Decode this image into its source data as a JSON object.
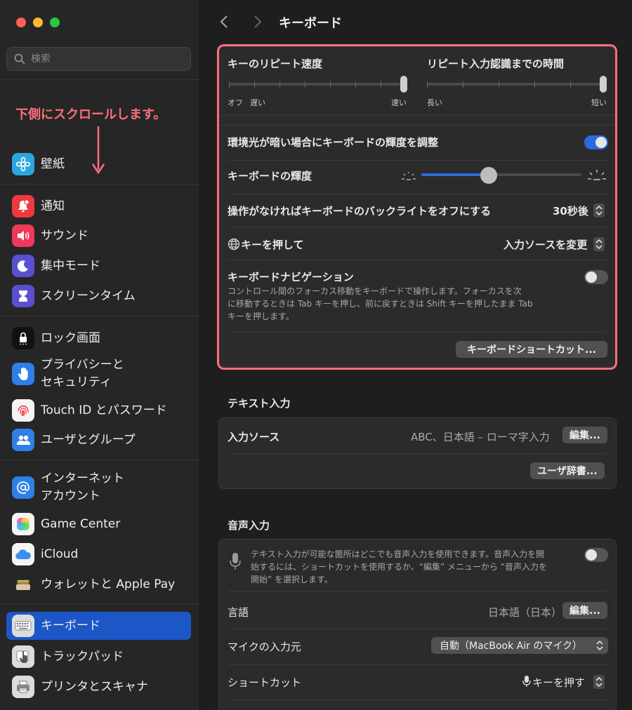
{
  "window": {
    "controls": [
      "close",
      "minimize",
      "zoom"
    ],
    "colors": {
      "close": "#ff5f57",
      "minimize": "#febc2e",
      "zoom": "#28c840"
    }
  },
  "search": {
    "placeholder": "検索"
  },
  "annotation": {
    "text": "下側にスクロールします。",
    "color": "#ff6f7d"
  },
  "sidebar": {
    "items": [
      {
        "label": "壁紙",
        "icon": "wallpaper-icon"
      },
      {
        "label": "通知",
        "icon": "notification-bell-icon"
      },
      {
        "label": "サウンド",
        "icon": "speaker-icon"
      },
      {
        "label": "集中モード",
        "icon": "moon-icon"
      },
      {
        "label": "スクリーンタイム",
        "icon": "hourglass-icon"
      },
      {
        "label": "ロック画面",
        "icon": "lock-icon"
      },
      {
        "label": "プライバシーと\nセキュリティ",
        "icon": "hand-icon"
      },
      {
        "label": "Touch ID とパスワード",
        "icon": "fingerprint-icon"
      },
      {
        "label": "ユーザとグループ",
        "icon": "users-icon"
      },
      {
        "label": "インターネット\nアカウント",
        "icon": "at-sign-icon"
      },
      {
        "label": "Game Center",
        "icon": "game-center-icon"
      },
      {
        "label": "iCloud",
        "icon": "cloud-icon"
      },
      {
        "label": "ウォレットと Apple Pay",
        "icon": "wallet-icon"
      },
      {
        "label": "キーボード",
        "icon": "keyboard-icon",
        "selected": true
      },
      {
        "label": "トラックパッド",
        "icon": "trackpad-icon"
      },
      {
        "label": "プリンタとスキャナ",
        "icon": "printer-icon"
      }
    ]
  },
  "page": {
    "title": "キーボード"
  },
  "keyboard": {
    "repeat_speed": {
      "label": "キーのリピート速度",
      "min_label": "オフ",
      "left_label": "遅い",
      "right_label": "速い",
      "value_fraction": 1.0
    },
    "repeat_delay": {
      "label": "リピート入力認識までの時間",
      "left_label": "長い",
      "right_label": "短い",
      "value_fraction": 1.0
    },
    "ambient_light": {
      "label": "環境光が暗い場合にキーボードの輝度を調整",
      "on": true
    },
    "brightness": {
      "label": "キーボードの輝度",
      "value_fraction": 0.42
    },
    "backlight_off": {
      "label": "操作がなければキーボードのバックライトをオフにする",
      "value": "30秒後"
    },
    "globe_key": {
      "label": "キーを押して",
      "value": "入力ソースを変更"
    },
    "navigation": {
      "label": "キーボードナビゲーション",
      "on": false,
      "desc_line1": "コントロール間のフォーカス移動をキーボードで操作します。フォーカスを次",
      "desc_line2": "に移動するときは Tab キーを押し、前に戻すときは Shift キーを押したまま Tab",
      "desc_line3": "キーを押します。"
    },
    "shortcuts_button": "キーボードショートカット..."
  },
  "text_input": {
    "title": "テキスト入力",
    "input_sources": {
      "label": "入力ソース",
      "value": "ABC、日本語 – ローマ字入力",
      "button": "編集..."
    },
    "user_dictionary_button": "ユーザ辞書..."
  },
  "dictation": {
    "title": "音声入力",
    "desc_line1": "テキスト入力が可能な箇所はどこでも音声入力を使用できます。音声入力を開",
    "desc_line2": "始するには、ショートカットを使用するか、“編集” メニューから “音声入力を",
    "desc_line3": "開始” を選択します。",
    "on": false,
    "language": {
      "label": "言語",
      "value": "日本語（日本）",
      "button": "編集..."
    },
    "mic_source": {
      "label": "マイクの入力元",
      "value": "自動（MacBook Air のマイク）"
    },
    "shortcut": {
      "label": "ショートカット",
      "value": "キーを押す"
    }
  },
  "colors": {
    "accent": "#1d56c7",
    "toggle_on": "#2a6bdf",
    "highlight": "#ff6f7d"
  }
}
